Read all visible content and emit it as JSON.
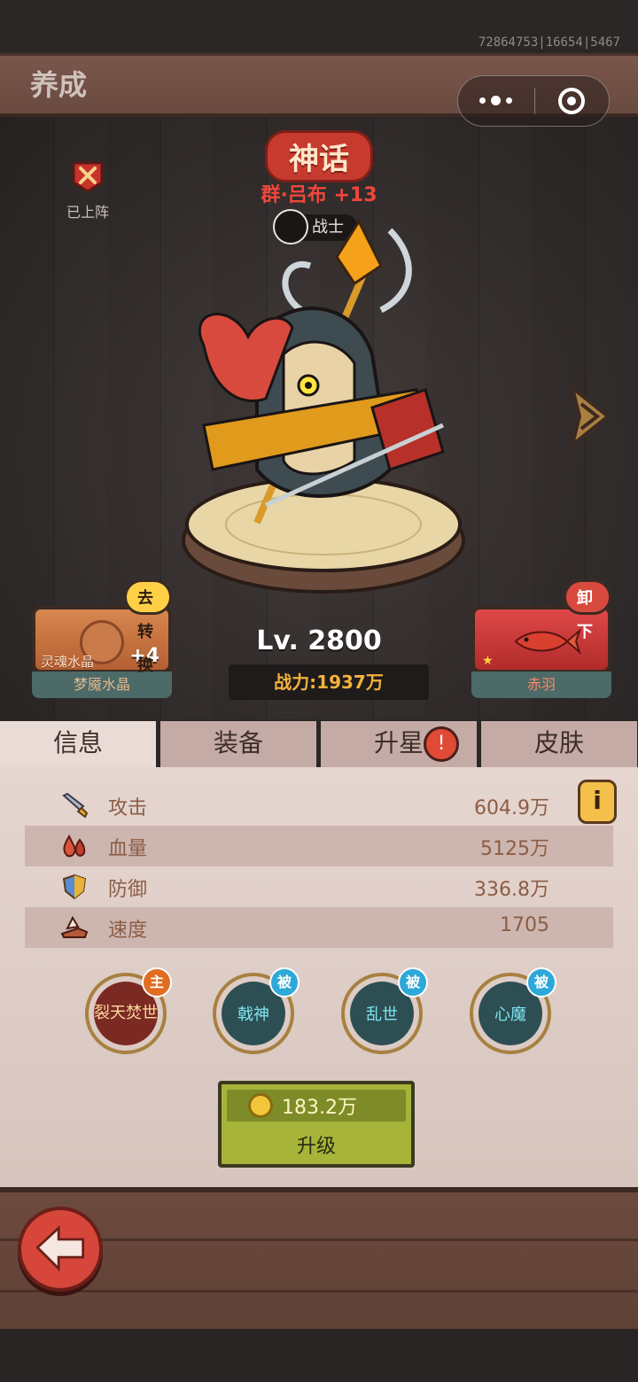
{
  "status": {
    "id_text": "72864753|16654|5467"
  },
  "header": {
    "title": "养成"
  },
  "hero": {
    "deployed_label": "已上阵",
    "rarity": "神话",
    "name": "群·吕布 +13",
    "class": "战士",
    "level": "Lv. 2800",
    "power": "战力:1937万"
  },
  "left_card": {
    "bubble": "去转换",
    "item_label": "灵魂水晶",
    "plus": "+4",
    "name": "梦魇水晶"
  },
  "right_card": {
    "bubble": "卸下",
    "name": "赤羽"
  },
  "tabs": [
    {
      "label": "信息"
    },
    {
      "label": "装备"
    },
    {
      "label": "升星",
      "badge": "!"
    },
    {
      "label": "皮肤"
    }
  ],
  "stats": [
    {
      "name": "攻击",
      "value": "604.9万",
      "icon": "sword-icon"
    },
    {
      "name": "血量",
      "value": "5125万",
      "icon": "blood-drop-icon"
    },
    {
      "name": "防御",
      "value": "336.8万",
      "icon": "shield-icon"
    },
    {
      "name": "速度",
      "value": "1705",
      "icon": "wing-boot-icon"
    }
  ],
  "info_button": "i",
  "skills": [
    {
      "name": "裂天焚世",
      "badge": "主"
    },
    {
      "name": "戟神",
      "badge": "被"
    },
    {
      "name": "乱世",
      "badge": "被"
    },
    {
      "name": "心魔",
      "badge": "被"
    }
  ],
  "upgrade": {
    "cost": "183.2万",
    "label": "升级"
  },
  "colors": {
    "accent_red": "#f0473a",
    "gold": "#f3b23c",
    "upgrade_green": "#a6b43a"
  }
}
